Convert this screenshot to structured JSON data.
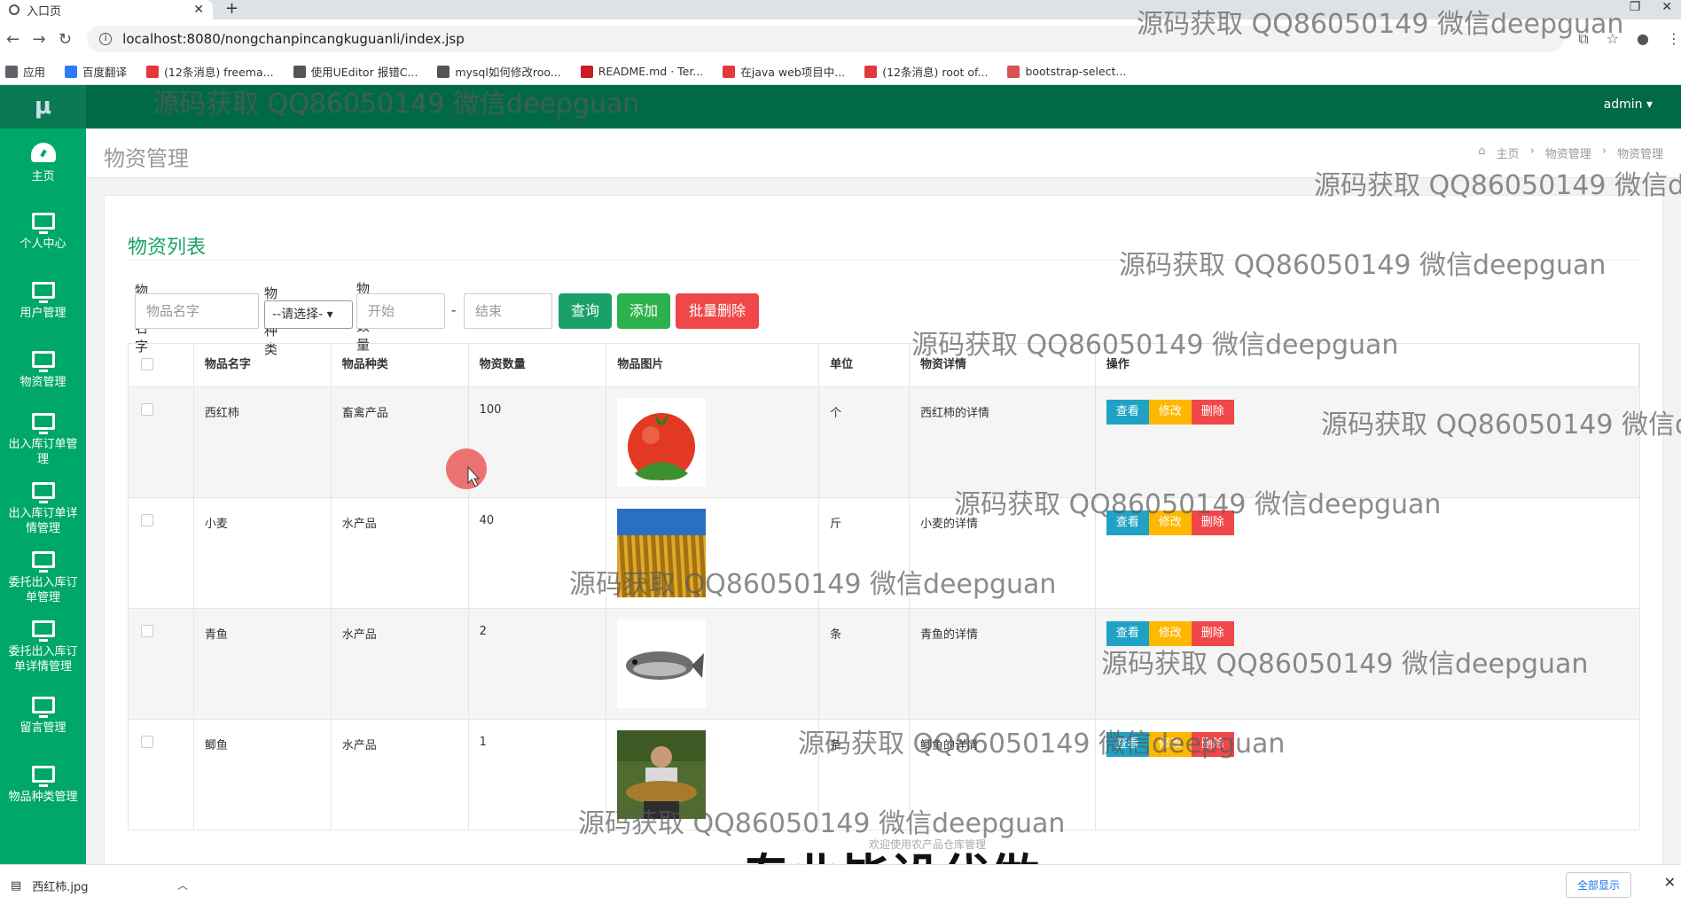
{
  "browser": {
    "tab_title": "入口页",
    "url": "localhost:8080/nongchanpincangkuguanli/index.jsp",
    "bookmarks": [
      {
        "label": "应用",
        "icon": "apps-icon",
        "color": "#5f6368"
      },
      {
        "label": "百度翻译",
        "icon": "baidu-translate-icon",
        "color": "#2f7cf6"
      },
      {
        "label": "(12条消息) freema...",
        "icon": "csdn-icon",
        "color": "#e4393c"
      },
      {
        "label": "使用UEditor 报错C...",
        "icon": "bookmark-icon",
        "color": "#555555"
      },
      {
        "label": "mysql如何修改roo...",
        "icon": "bookmark-icon",
        "color": "#555555"
      },
      {
        "label": "README.md · Ter...",
        "icon": "gitee-icon",
        "color": "#c71d23"
      },
      {
        "label": "在java web项目中...",
        "icon": "csdn-icon",
        "color": "#e4393c"
      },
      {
        "label": "(12条消息) root of...",
        "icon": "csdn-icon",
        "color": "#e4393c"
      },
      {
        "label": "bootstrap-select...",
        "icon": "bookmark-icon",
        "color": "#d9534f"
      }
    ]
  },
  "app": {
    "logo": "μ",
    "user": "admin ▾",
    "sidebar": [
      {
        "label": "主页",
        "icon": "dashboard-icon"
      },
      {
        "label": "个人中心",
        "icon": "monitor-icon"
      },
      {
        "label": "用户管理",
        "icon": "monitor-icon"
      },
      {
        "label": "物资管理",
        "icon": "monitor-icon"
      },
      {
        "label": "出入库订单管理",
        "icon": "monitor-icon"
      },
      {
        "label": "出入库订单详情管理",
        "icon": "monitor-icon"
      },
      {
        "label": "委托出入库订单管理",
        "icon": "monitor-icon"
      },
      {
        "label": "委托出入库订单详情管理",
        "icon": "monitor-icon"
      },
      {
        "label": "留言管理",
        "icon": "monitor-icon"
      },
      {
        "label": "物品种类管理",
        "icon": "monitor-icon"
      }
    ],
    "page_title": "物资管理",
    "breadcrumb": [
      "主页",
      "›",
      "物资管理",
      "›",
      "物资管理"
    ],
    "list_title": "物资列表",
    "filters": {
      "name_label": "物品名字",
      "name_placeholder": "物品名字",
      "type_label": "物品种类",
      "type_selected": "--请选择-",
      "qty_label": "物资数量",
      "qty_start_placeholder": "开始",
      "qty_dash": "-",
      "qty_end_placeholder": "结束",
      "query_button": "查询",
      "add_button": "添加",
      "batch_delete_button": "批量删除"
    },
    "table": {
      "headers": [
        "物品名字",
        "物品种类",
        "物资数量",
        "物品图片",
        "单位",
        "物资详情",
        "操作"
      ],
      "rows": [
        {
          "name": "西红柿",
          "type": "畜禽产品",
          "qty": "100",
          "image": "tomato",
          "unit": "个",
          "detail": "西红柿的详情"
        },
        {
          "name": "小麦",
          "type": "水产品",
          "qty": "40",
          "image": "wheat",
          "unit": "斤",
          "detail": "小麦的详情"
        },
        {
          "name": "青鱼",
          "type": "水产品",
          "qty": "2",
          "image": "fish",
          "unit": "条",
          "detail": "青鱼的详情"
        },
        {
          "name": "鲫鱼",
          "type": "水产品",
          "qty": "1",
          "image": "carp",
          "unit": "条",
          "detail": "鲫鱼的详情"
        }
      ],
      "actions": {
        "view": "查看",
        "edit": "修改",
        "delete": "删除"
      }
    },
    "footer": "欢迎使用农产品仓库管理"
  },
  "overlay": {
    "watermark": "源码获取 QQ86050149 微信deepguan",
    "subtitle": "专业毕设代做"
  },
  "downloads": {
    "file": "西红柿.jpg",
    "show_all": "全部显示"
  },
  "colors": {
    "topbar": "#006a45",
    "sidebar": "#00a76a",
    "query": "#1aa069",
    "add": "#2bb24c",
    "danger": "#f0474a",
    "view": "#1fa2c4",
    "edit": "#ffb800",
    "delete": "#f0474a"
  }
}
